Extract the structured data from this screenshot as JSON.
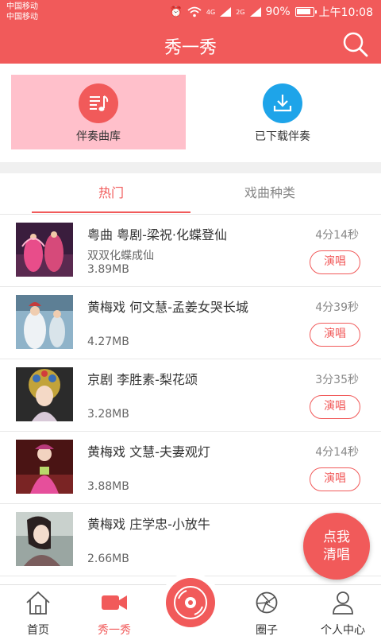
{
  "status_bar": {
    "carrier_1": "中国移动",
    "carrier_2": "中国移动",
    "network_1": "4G",
    "network_2": "2G",
    "battery": "90%",
    "time": "上午10:08"
  },
  "header": {
    "title": "秀一秀",
    "search_icon": "search-icon"
  },
  "categories": [
    {
      "label": "伴奏曲库",
      "icon": "music-library-icon",
      "color": "#f15a5a",
      "selected": true
    },
    {
      "label": "已下载伴奏",
      "icon": "download-icon",
      "color": "#1ea4e9",
      "selected": false
    }
  ],
  "tabs": [
    {
      "label": "热门",
      "active": true
    },
    {
      "label": "戏曲种类",
      "active": false
    }
  ],
  "songs": [
    {
      "title": "粤曲 粤剧-梁祝·化蝶登仙",
      "subtitle": "双双化蝶成仙",
      "size": "3.89MB",
      "duration": "4分14秒",
      "action": "演唱"
    },
    {
      "title": "黄梅戏 何文慧-孟姜女哭长城",
      "subtitle": "",
      "size": "4.27MB",
      "duration": "4分39秒",
      "action": "演唱"
    },
    {
      "title": "京剧 李胜素-梨花颂",
      "subtitle": "",
      "size": "3.28MB",
      "duration": "3分35秒",
      "action": "演唱"
    },
    {
      "title": "黄梅戏 文慧-夫妻观灯",
      "subtitle": "",
      "size": "3.88MB",
      "duration": "4分14秒",
      "action": "演唱"
    },
    {
      "title": "黄梅戏 庄学忠-小放牛",
      "subtitle": "",
      "size": "2.66MB",
      "duration": "",
      "action": ""
    }
  ],
  "fab": {
    "line1": "点我",
    "line2": "清唱"
  },
  "bottom_nav": [
    {
      "label": "首页",
      "icon": "home-icon",
      "active": false
    },
    {
      "label": "秀一秀",
      "icon": "video-camera-icon",
      "active": true
    },
    {
      "label": "",
      "icon": "record-disc-icon",
      "active": false
    },
    {
      "label": "圈子",
      "icon": "aperture-icon",
      "active": false
    },
    {
      "label": "个人中心",
      "icon": "user-icon",
      "active": false
    }
  ],
  "colors": {
    "primary": "#f15a5a",
    "download_blue": "#1ea4e9",
    "selected_bg": "#ffc0cb"
  }
}
